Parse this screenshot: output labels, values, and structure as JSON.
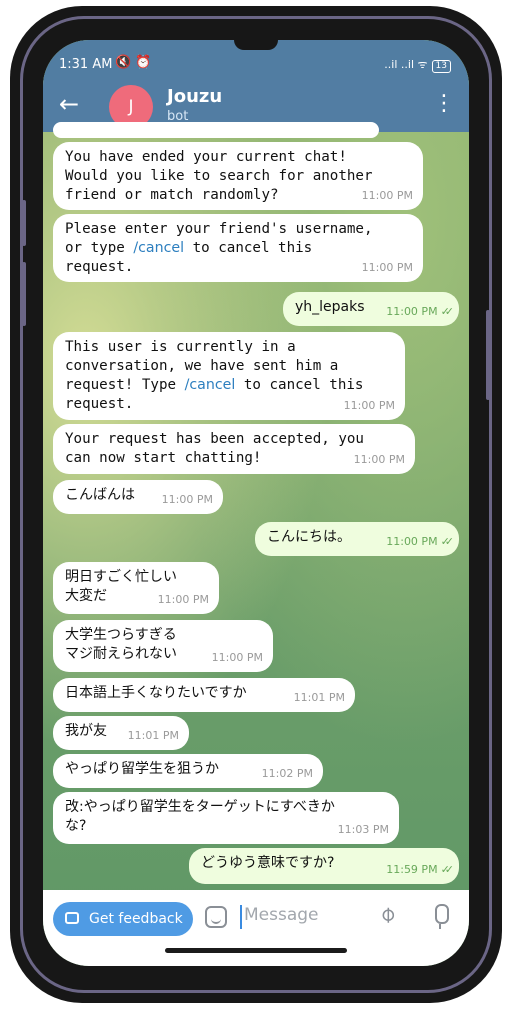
{
  "status_bar": {
    "time": "1:31 AM",
    "icons": "🔇 ⏰",
    "right": "..il ..il ᯤ",
    "battery": "13"
  },
  "header": {
    "back_icon": "arrow-left-icon",
    "avatar_letter": "J",
    "avatar_color": "#ef6b7b",
    "title": "Jouzu",
    "subtitle": "bot"
  },
  "messages": [
    {
      "dir": "in",
      "lines": "You have ended your current chat!\nWould you like to search for another\nfriend or match randomly?",
      "time": "11:00 PM"
    },
    {
      "dir": "in",
      "pre": "Please enter your friend's username,\nor type ",
      "link": "/cancel",
      "post": " to cancel this\nrequest.",
      "time": "11:00 PM"
    },
    {
      "dir": "out",
      "text": "yh_lepaks",
      "time": "11:00 PM"
    },
    {
      "dir": "in",
      "pre": "This user is currently in a\nconversation, we have sent him a\nrequest! Type ",
      "link": "/cancel",
      "post": " to cancel this\nrequest.",
      "time": "11:00 PM"
    },
    {
      "dir": "in",
      "lines": "Your request has been accepted, you\ncan now start chatting!",
      "time": "11:00 PM"
    },
    {
      "dir": "in",
      "text": "こんばんは",
      "time": "11:00 PM"
    },
    {
      "dir": "out",
      "text": "こんにちは。",
      "time": "11:00 PM"
    },
    {
      "dir": "in",
      "text": "明日すごく忙しい\n大変だ",
      "time": "11:00 PM"
    },
    {
      "dir": "in",
      "text": "大学生つらすぎる\nマジ耐えられない",
      "time": "11:00 PM"
    },
    {
      "dir": "in",
      "text": "日本語上手くなりたいですか",
      "time": "11:01 PM"
    },
    {
      "dir": "in",
      "text": "我が友",
      "time": "11:01 PM"
    },
    {
      "dir": "in",
      "text": "やっぱり留学生を狙うか",
      "time": "11:02 PM"
    },
    {
      "dir": "in",
      "text": "改:やっぱり留学生をターゲットにすべきか\nな?",
      "time": "11:03 PM"
    },
    {
      "dir": "out",
      "text": "どうゆう意味ですか?",
      "time": "11:59 PM"
    }
  ],
  "bottom_bar": {
    "feedback_label": "Get feedback",
    "input_placeholder": "Message"
  },
  "colors": {
    "header": "#527da3",
    "incoming": "#ffffff",
    "outgoing": "#effdde",
    "link": "#2d7fbf",
    "feedback": "#4f9be4"
  }
}
